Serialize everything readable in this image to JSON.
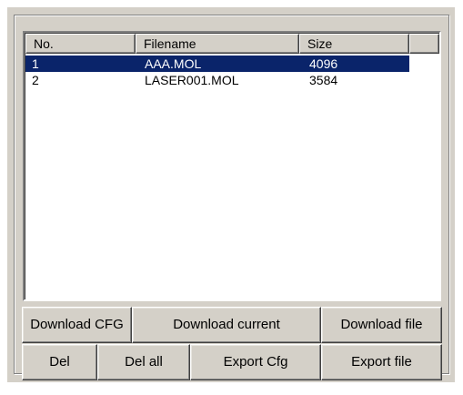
{
  "list": {
    "columns": [
      "No.",
      "Filename",
      "Size",
      ""
    ],
    "rows": [
      {
        "no": "1",
        "filename": "AAA.MOL",
        "size": "4096",
        "selected": true
      },
      {
        "no": "2",
        "filename": "LASER001.MOL",
        "size": "3584",
        "selected": false
      }
    ]
  },
  "buttons": {
    "download_cfg": "Download CFG",
    "download_current": "Download current",
    "download_file": "Download file",
    "del": "Del",
    "del_all": "Del all",
    "export_cfg": "Export Cfg",
    "export_file": "Export file"
  },
  "colors": {
    "face": "#d4d0c8",
    "selection": "#0a246a",
    "selection_text": "#ffffff"
  }
}
